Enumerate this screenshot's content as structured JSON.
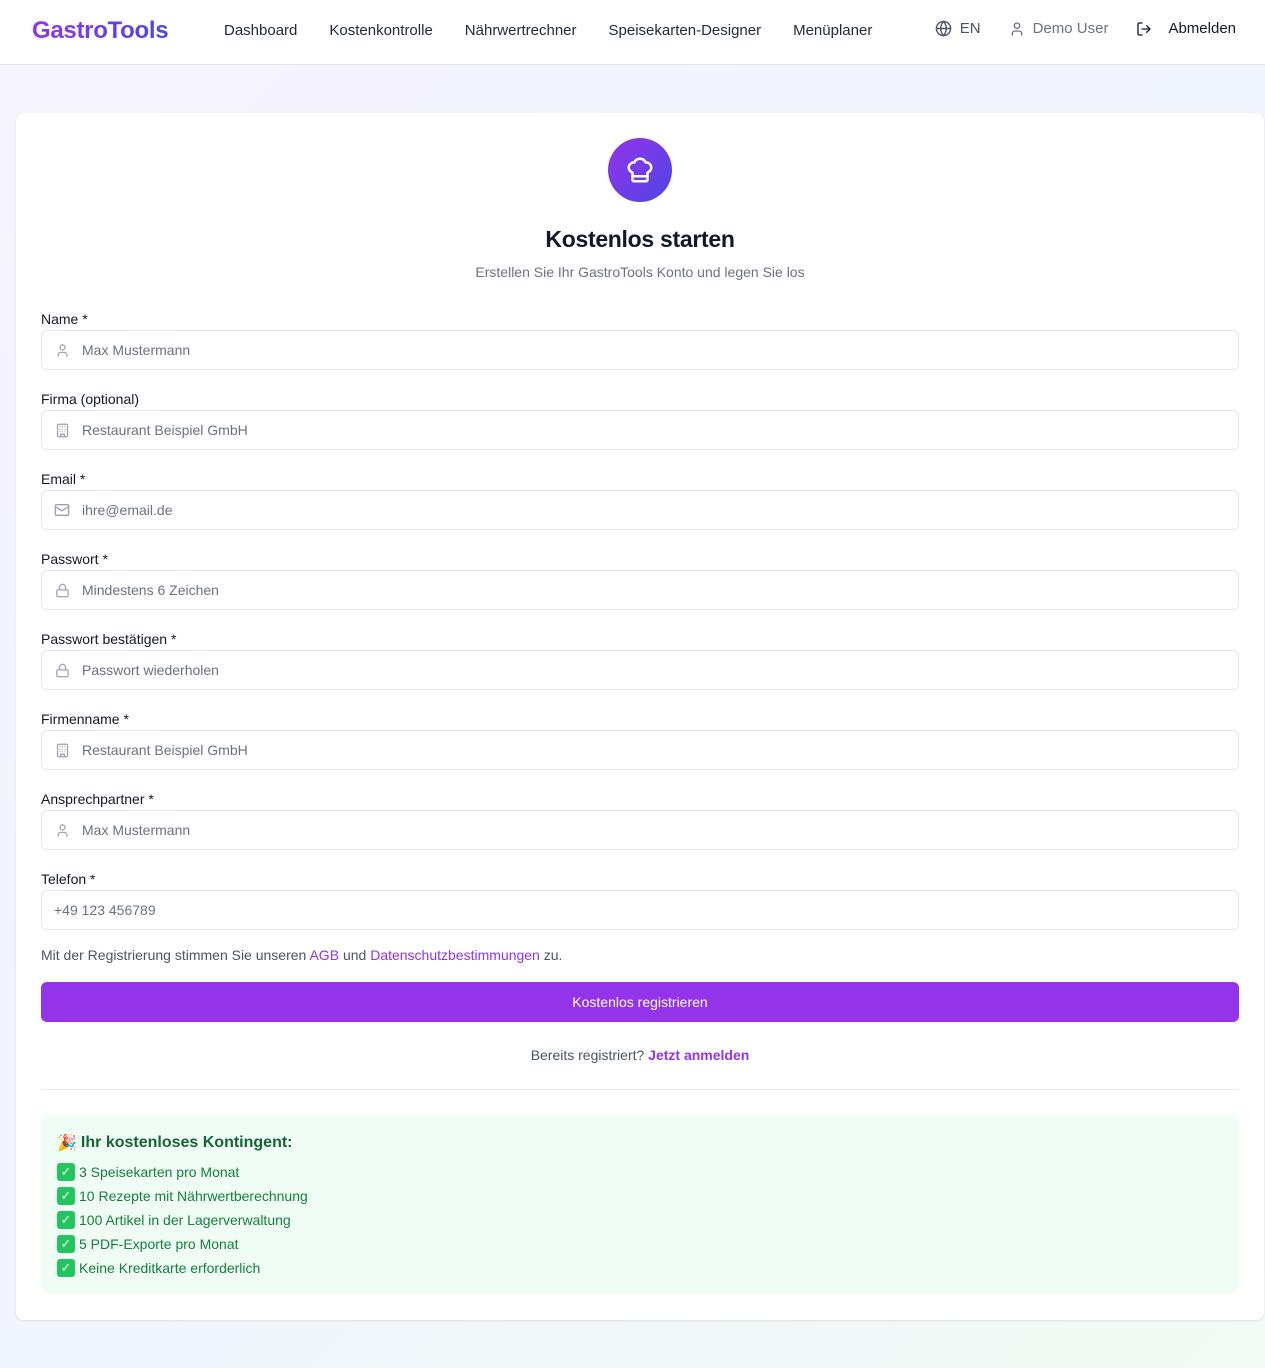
{
  "nav": {
    "brand": "GastroTools",
    "links": [
      "Dashboard",
      "Kostenkontrolle",
      "Nährwertrechner",
      "Speisekarten-Designer",
      "Menüplaner"
    ],
    "lang": "EN",
    "user": "Demo User",
    "logout": "Abmelden"
  },
  "card": {
    "title": "Kostenlos starten",
    "subtitle": "Erstellen Sie Ihr GastroTools Konto und legen Sie los"
  },
  "fields": {
    "name": {
      "label": "Name *",
      "placeholder": "Max Mustermann",
      "icon": "user-icon"
    },
    "company_optional": {
      "label": "Firma (optional)",
      "placeholder": "Restaurant Beispiel GmbH",
      "icon": "building-icon"
    },
    "email": {
      "label": "Email *",
      "placeholder": "ihre@email.de",
      "icon": "mail-icon"
    },
    "password": {
      "label": "Passwort *",
      "placeholder": "Mindestens 6 Zeichen",
      "icon": "lock-icon"
    },
    "password_confirm": {
      "label": "Passwort bestätigen *",
      "placeholder": "Passwort wiederholen",
      "icon": "lock-icon"
    },
    "company_name": {
      "label": "Firmenname *",
      "placeholder": "Restaurant Beispiel GmbH",
      "icon": "building-icon"
    },
    "contact": {
      "label": "Ansprechpartner *",
      "placeholder": "Max Mustermann",
      "icon": "user-icon"
    },
    "phone": {
      "label": "Telefon *",
      "placeholder": "+49 123 456789"
    }
  },
  "terms": {
    "prefix": "Mit der Registrierung stimmen Sie unseren",
    "agb": "AGB",
    "and": "und",
    "privacy": "Datenschutzbestimmungen",
    "suffix": "zu."
  },
  "submit_label": "Kostenlos registrieren",
  "login": {
    "prompt": "Bereits registriert?",
    "link": "Jetzt anmelden"
  },
  "quota": {
    "emoji": "🎉",
    "title": "Ihr kostenloses Kontingent:",
    "items": [
      "3 Speisekarten pro Monat",
      "10 Rezepte mit Nährwertberechnung",
      "100 Artikel in der Lagerverwaltung",
      "5 PDF-Exporte pro Monat",
      "Keine Kreditkarte erforderlich"
    ]
  },
  "colors": {
    "accent": "#9333ea",
    "accent_secondary": "#4f46e5",
    "success_bg": "#f0fdf4",
    "success_text": "#15803d"
  }
}
